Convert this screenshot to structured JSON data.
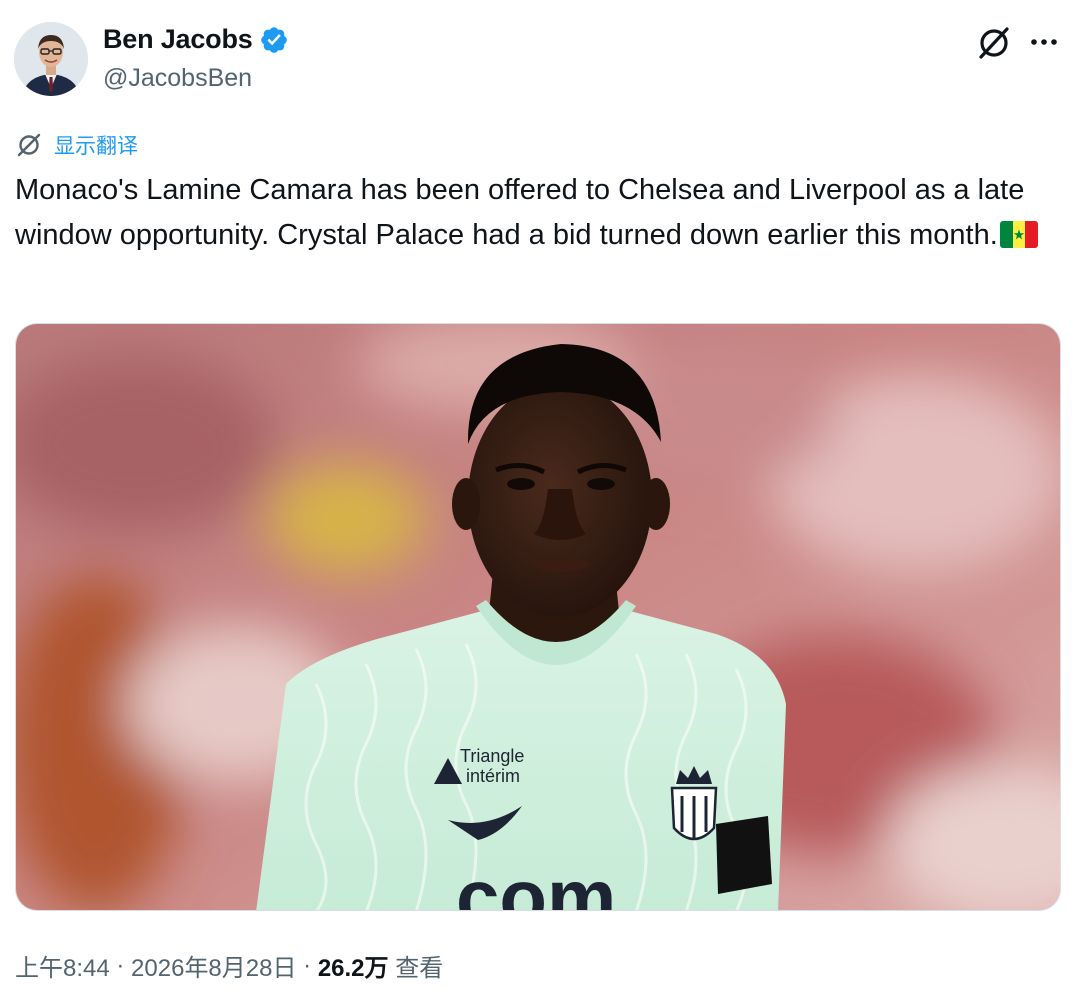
{
  "author": {
    "display_name": "Ben Jacobs",
    "handle": "@JacobsBen",
    "verified": true
  },
  "translate_label": "显示翻译",
  "tweet_text": "Monaco's Lamine Camara has been offered to Chelsea and Liverpool as a late window opportunity. Crystal Palace had a bid turned down earlier this month.",
  "tweet_emoji": "senegal-flag",
  "media": {
    "sponsor_line1": "Triangle",
    "sponsor_line2": "intérim",
    "shirt_text": "com"
  },
  "meta": {
    "time": "上午8:44",
    "separator": " · ",
    "date": "2026年8月28日",
    "views_count": "26.2万",
    "views_label": " 查看"
  },
  "colors": {
    "accent": "#1d9bf0",
    "secondary_text": "#536471",
    "primary_text": "#0f1419",
    "verified_badge": "#1d9bf0",
    "jersey": "#cdeedd"
  }
}
